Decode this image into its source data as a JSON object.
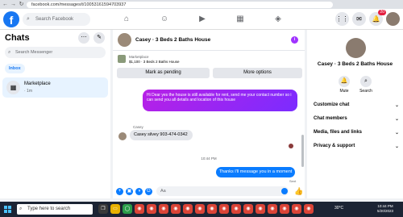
{
  "browser": {
    "back": "←",
    "forward": "→",
    "reload": "↻",
    "url": "facebook.com/messages/t/10053161594703937"
  },
  "header": {
    "logo": "f",
    "search_placeholder": "Search Facebook",
    "nav_icons": [
      "home-icon",
      "friends-icon",
      "watch-icon",
      "marketplace-icon",
      "gaming-icon"
    ],
    "notification_count": "20"
  },
  "chats": {
    "title": "Chats",
    "search_placeholder": "Search Messenger",
    "inbox_label": "Inbox",
    "items": [
      {
        "title": "Marketplace",
        "time": "· 1m"
      }
    ]
  },
  "conversation": {
    "title": "Casey · 3 Beds 2 Baths House",
    "marketplace_label": "Marketplace",
    "listing": "$1,100 · 3 Beds 2 Baths House",
    "mark_pending": "Mark as pending",
    "more_options": "More options",
    "messages": [
      {
        "dir": "out",
        "text": "Hi Dear yes the house is still available for rent, send me your contact number so i can send you all details and location of this house"
      },
      {
        "dir": "in",
        "sender": "Casey",
        "text": "Casey silvey 903-474-0342"
      },
      {
        "dir": "out",
        "text": "Thanks I'll message you in a moment"
      }
    ],
    "timestamp": "10:44 PM",
    "sent_label": "Sent",
    "composer_placeholder": "Aa"
  },
  "details": {
    "name": "Casey · 3 Beds 2 Baths House",
    "mute_label": "Mute",
    "search_label": "Search",
    "sections": [
      "Customize chat",
      "Chat members",
      "Media, files and links",
      "Privacy & support"
    ]
  },
  "taskbar": {
    "search_placeholder": "Type here to search",
    "temperature": "30°C",
    "time": "10:44 PM",
    "date": "5/20/2023"
  },
  "colors": {
    "fb_blue": "#1877f2",
    "messenger_purple": "#a033ff",
    "outgoing_blue": "#0a7cff"
  }
}
